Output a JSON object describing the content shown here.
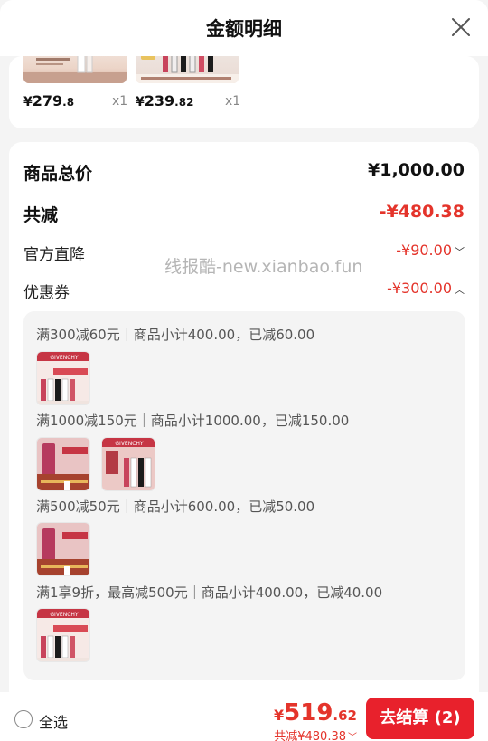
{
  "header": {
    "title": "金额明细"
  },
  "top_items": [
    {
      "price_cur": "¥",
      "price_int": "279",
      "price_dec": ".8",
      "qty": "x1"
    },
    {
      "price_cur": "¥",
      "price_int": "239",
      "price_dec": ".82",
      "qty": "x1"
    }
  ],
  "summary": {
    "goods_total_label": "商品总价",
    "goods_total_value": "¥1,000.00",
    "total_discount_label": "共减",
    "total_discount_value": "-¥480.38",
    "official_label": "官方直降",
    "official_value": "-¥90.00",
    "coupon_label": "优惠券",
    "coupon_value": "-¥300.00"
  },
  "watermark": "线报酷-new.xianbao.fun",
  "coupons": [
    {
      "text": "满300减60元｜商品小计400.00，已减60.00"
    },
    {
      "text": "满1000减150元｜商品小计1000.00，已减150.00"
    },
    {
      "text": "满500减50元｜商品小计600.00，已减50.00"
    },
    {
      "text": "满1享9折，最高减500元｜商品小计400.00，已减40.00"
    }
  ],
  "product_labels": {
    "givenchy": "GIVENCHY"
  },
  "bottom": {
    "select_all": "全选",
    "total_cur": "¥",
    "total_int": "519",
    "total_dec": ".62",
    "total_discount": "共减¥480.38",
    "checkout": "去结算 (2)"
  },
  "colors": {
    "accent_red": "#e4342b",
    "button_red": "#e8212c"
  }
}
